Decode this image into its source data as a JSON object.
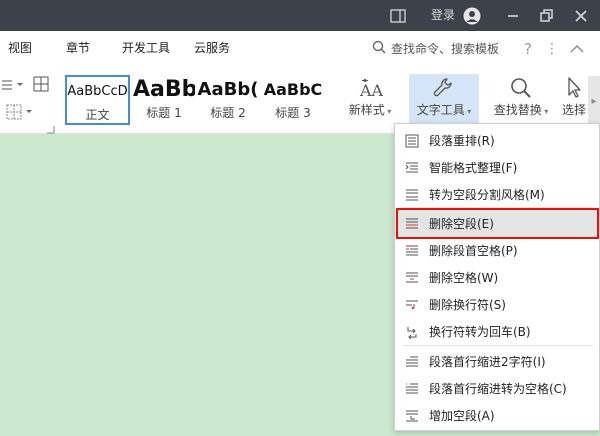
{
  "titlebar": {
    "login_label": "登录"
  },
  "menu": {
    "items": [
      "视图",
      "章节",
      "开发工具",
      "云服务"
    ],
    "search_placeholder": "查找命令、搜索模板"
  },
  "ribbon": {
    "styles": [
      {
        "sample": "AaBbCcD",
        "caption": "正文"
      },
      {
        "sample": "AaBb",
        "caption": "标题 1"
      },
      {
        "sample": "AaBb(",
        "caption": "标题 2"
      },
      {
        "sample": "AaBbC",
        "caption": "标题 3"
      }
    ],
    "new_style_label": "新样式",
    "text_tool_label": "文字工具",
    "find_replace_label": "查找替换",
    "select_label": "选择"
  },
  "dropdown": {
    "items": [
      {
        "label": "段落重排(R)",
        "icon": "paragraph-rearrange-icon"
      },
      {
        "label": "智能格式整理(F)",
        "icon": "smart-format-icon"
      },
      {
        "label": "转为空段分割风格(M)",
        "icon": "empty-para-split-icon"
      },
      {
        "label": "删除空段(E)",
        "icon": "delete-empty-para-icon"
      },
      {
        "label": "删除段首空格(P)",
        "icon": "delete-leading-space-icon"
      },
      {
        "label": "删除空格(W)",
        "icon": "delete-space-icon"
      },
      {
        "label": "删除换行符(S)",
        "icon": "delete-line-break-icon"
      },
      {
        "label": "换行符转为回车(B)",
        "icon": "line-break-to-enter-icon"
      },
      {
        "label": "段落首行缩进2字符(I)",
        "icon": "first-line-indent-icon"
      },
      {
        "label": "段落首行缩进转为空格(C)",
        "icon": "indent-to-space-icon"
      },
      {
        "label": "增加空段(A)",
        "icon": "add-empty-para-icon"
      }
    ],
    "highlighted_index": 3
  },
  "colors": {
    "titlebar_bg": "#3d4149",
    "doc_bg": "#cce8cf",
    "highlight_border": "#e3120b",
    "active_tool_bg": "#d6e6f9"
  }
}
